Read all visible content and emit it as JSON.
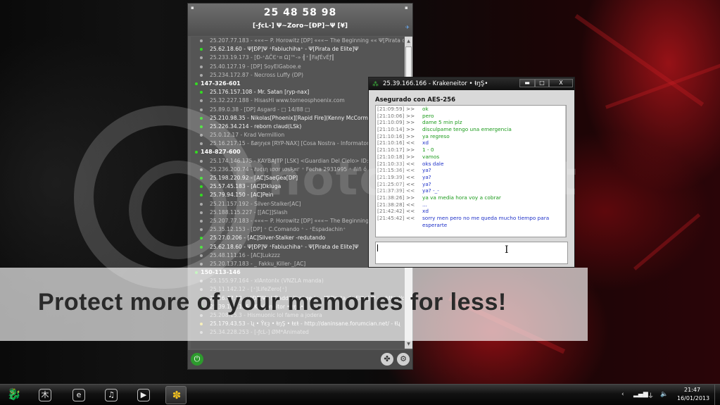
{
  "watermark": {
    "word": "Photobucket",
    "banner": "Protect more of your memories for less!"
  },
  "buddy_window": {
    "uin": "25 48 58 98",
    "nickname": "[-ƒcL-] Ψ~Zoro~[ĐP]~Ψ [¥]",
    "entries": [
      {
        "kind": "buddy",
        "status": "off",
        "text": "25.207.77.183 - «««~ P. Horowitz [DP] «««~ The Beginning «« Ψ[Pirata de Elite]Ψ"
      },
      {
        "kind": "buddy",
        "status": "on",
        "text": "25.62.18.60 - Ψ[ĐP]Ψ ⁺Fabiuchiha⁺ - Ψ[Pirata de Elite]Ψ"
      },
      {
        "kind": "buddy",
        "status": "off",
        "text": "25.233.19.173 - [Đ-⁺ΔĈЄ⁺¤ Ω]™-» ╣⁺║FaƒÉvÉƒ║"
      },
      {
        "kind": "buddy",
        "status": "off",
        "text": "25.40.127.19 - [DP] SoyElGaboe.e"
      },
      {
        "kind": "buddy",
        "status": "off",
        "text": "25.234.172.87 - Necross Luffy (DP)"
      },
      {
        "kind": "group",
        "text": "147-326-601"
      },
      {
        "kind": "buddy",
        "status": "on",
        "text": "25.176.157.108 - Mr. Satan [ryp-nax]"
      },
      {
        "kind": "buddy",
        "status": "off",
        "text": "25.32.227.188 - HisasHi www.torneosphoenix.com"
      },
      {
        "kind": "buddy",
        "status": "off",
        "text": "25.89.0.38 - [DP] Asgard - □ 14/88 □"
      },
      {
        "kind": "buddy",
        "status": "on",
        "text": "25.210.98.35 - Nikolas[Phoenix][Rapid Fire](Kenny McCormick)"
      },
      {
        "kind": "buddy",
        "status": "on",
        "text": "25.226.34.214 - reborn claud(LSk)"
      },
      {
        "kind": "buddy",
        "status": "off",
        "text": "25.0.12.17 - Krad Vermillion"
      },
      {
        "kind": "buddy",
        "status": "off",
        "text": "25.16.217.15 - ßøŋηєя [RYP-NAX] [Cosa Nostra - Informatorio]"
      },
      {
        "kind": "group",
        "text": "148-827-600"
      },
      {
        "kind": "buddy",
        "status": "off",
        "text": "25.174.146.175 - KAYBAJTP [LSK] <Guardian Del Cielo> ID: 2"
      },
      {
        "kind": "buddy",
        "status": "off",
        "text": "25.236.200.74 - ℓυ¢ιη ισσr ισѕђ¤г ⁺ Fecha 2931995 ⁺ ñiñ ó"
      },
      {
        "kind": "buddy",
        "status": "on",
        "text": "25.198.220.92 - [AC]SaeĢea[DP]"
      },
      {
        "kind": "buddy",
        "status": "on",
        "text": "25.57.45.183 - [AC]Dkluga"
      },
      {
        "kind": "buddy",
        "status": "on",
        "text": "25.79.94.150 - [AC]Pein"
      },
      {
        "kind": "buddy",
        "status": "off",
        "text": "25.21.157.192 - Silver-Stalker[AC]"
      },
      {
        "kind": "buddy",
        "status": "off",
        "text": "25.188.115.227 - [[AC]]Slash"
      },
      {
        "kind": "buddy",
        "status": "off",
        "text": "25.207.77.183 - «««~ P. Horowitz [DP] «««~ The Beginning «« Ψ[Pirata de Elite]Ψ"
      },
      {
        "kind": "buddy",
        "status": "off",
        "text": "25.35.12.153 - [DP] ⁺ C.Comando ⁺ - ⁺Espadachin⁺"
      },
      {
        "kind": "buddy",
        "status": "on",
        "text": "25.27.0.206 - [AC]Silver-Stalker -redutando"
      },
      {
        "kind": "buddy",
        "status": "on",
        "text": "25.62.18.60 - Ψ[ĐP]Ψ ⁺Fabiuchiha⁺ - Ψ[Pirata de Elite]Ψ"
      },
      {
        "kind": "buddy",
        "status": "off",
        "text": "25.48.111.16 - [AC]Lukzzz"
      },
      {
        "kind": "buddy",
        "status": "off",
        "text": "25.20.137.183 - _ Fakku_Killer-_[AC]"
      },
      {
        "kind": "group",
        "text": "150-113-146"
      },
      {
        "kind": "buddy",
        "status": "off",
        "text": "25.155.97.164 - xIAntonIx (VNZLA manda)"
      },
      {
        "kind": "buddy",
        "status": "off",
        "text": "25.11.142.12 - [⁺]LifeZero[⁺]"
      },
      {
        "kind": "buddy",
        "status": "on",
        "text": "25.16.47.13 - ⁺[ĐP]Ψ ⁺! Daddy Yankee !⁺ - Ψ[Pirata de Elite] Ψ - ⁺ http://danin"
      },
      {
        "kind": "buddy",
        "status": "on",
        "text": "25.39.166.166 - Krakeneitor • ŧŋŞ•"
      },
      {
        "kind": "buddy",
        "status": "off",
        "text": "25.208.15.3 - Hismuonic lol fame a jodera"
      },
      {
        "kind": "buddy",
        "status": "yel",
        "text": "25.179.43.53 - ʯ • Ÿεȝ • ŧŋŞ • ŧεŧ - http://daninsane.forumcian.net/ - ŧʯ"
      },
      {
        "kind": "buddy",
        "status": "off",
        "text": "25.34.228.253 - [-ƒcL-] ØM*Animated"
      }
    ]
  },
  "chat_window": {
    "title": "25.39.166.166 - Krakeneitor • ŧŋŞ•",
    "security": "Asegurado con AES-256",
    "minimize": "▬",
    "maximize": "□",
    "close": "X",
    "messages": [
      {
        "dir": "out",
        "ts": "[21:09:59]",
        "arrow": ">>",
        "text": "ok"
      },
      {
        "dir": "out",
        "ts": "[21:10:06]",
        "arrow": ">>",
        "text": "pero"
      },
      {
        "dir": "out",
        "ts": "[21:10:09]",
        "arrow": ">>",
        "text": "dame 5 min plz"
      },
      {
        "dir": "out",
        "ts": "[21:10:14]",
        "arrow": ">>",
        "text": "disculpame tengo una emergencia"
      },
      {
        "dir": "out",
        "ts": "[21:10:16]",
        "arrow": ">>",
        "text": "ya regreso"
      },
      {
        "dir": "in",
        "ts": "[21:10:16]",
        "arrow": "<<",
        "text": "xd"
      },
      {
        "dir": "out",
        "ts": "[21:10:17]",
        "arrow": ">>",
        "text": "1 - 0"
      },
      {
        "dir": "out",
        "ts": "[21:10:18]",
        "arrow": ">>",
        "text": "vamos"
      },
      {
        "dir": "in",
        "ts": "[21:10:33]",
        "arrow": "<<",
        "text": "oks dale"
      },
      {
        "dir": "in",
        "ts": "[21:15:36]",
        "arrow": "<<",
        "text": "ya?"
      },
      {
        "dir": "in",
        "ts": "[21:19:39]",
        "arrow": "<<",
        "text": "ya?"
      },
      {
        "dir": "in",
        "ts": "[21:25:07]",
        "arrow": "<<",
        "text": "ya?"
      },
      {
        "dir": "in",
        "ts": "[21:37:39]",
        "arrow": "<<",
        "text": "ya? -_-"
      },
      {
        "dir": "out",
        "ts": "[21:38:26]",
        "arrow": ">>",
        "text": "ya va media hora voy a cobrar"
      },
      {
        "dir": "in",
        "ts": "[21:38:28]",
        "arrow": "<<",
        "text": "..."
      },
      {
        "dir": "in",
        "ts": "[21:42:42]",
        "arrow": "<<",
        "text": "xd"
      },
      {
        "dir": "in",
        "ts": "[21:45:42]",
        "arrow": "<<",
        "text": "sorry men pero no me queda mucho tiempo para esperarte",
        "wrap": true
      }
    ],
    "input_value": ""
  },
  "taskbar": {
    "apps": [
      {
        "name": "start-dragon-icon",
        "glyph": "🐉"
      },
      {
        "name": "app-wood-icon",
        "glyph": "木"
      },
      {
        "name": "internet-explorer-icon",
        "glyph": "e"
      },
      {
        "name": "windows-media-player-icon",
        "glyph": "♫"
      },
      {
        "name": "media-center-icon",
        "glyph": "▶"
      },
      {
        "name": "chat-app-icon",
        "glyph": "✽"
      }
    ],
    "time": "21:47",
    "date": "16/01/2013"
  },
  "colors": {
    "online": "#33dd22",
    "outgoing_text": "#1a9a1a",
    "incoming_text": "#1e30c8",
    "wallpaper_red": "#aa1419"
  }
}
